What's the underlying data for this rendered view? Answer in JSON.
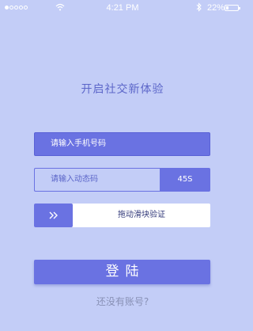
{
  "status_bar": {
    "time": "4:21 PM",
    "battery": "22%",
    "battery_level": 0.22,
    "signal_bars_filled": 1,
    "signal_bars_total": 5
  },
  "form": {
    "title": "开启社交新体验",
    "phone_placeholder": "请输入手机号码",
    "code_placeholder": "请输入动态码",
    "code_timer": "45S",
    "slider_text": "拖动滑块验证",
    "login_label": "登陆",
    "register_link": "还没有账号?"
  },
  "colors": {
    "background": "#c3cdf7",
    "accent": "#6a72e2",
    "title": "#5c66c9"
  },
  "icons": {
    "slider_handle": "double-chevron-right-icon",
    "wifi": "wifi-icon",
    "bluetooth": "bluetooth-icon",
    "battery": "battery-icon"
  }
}
